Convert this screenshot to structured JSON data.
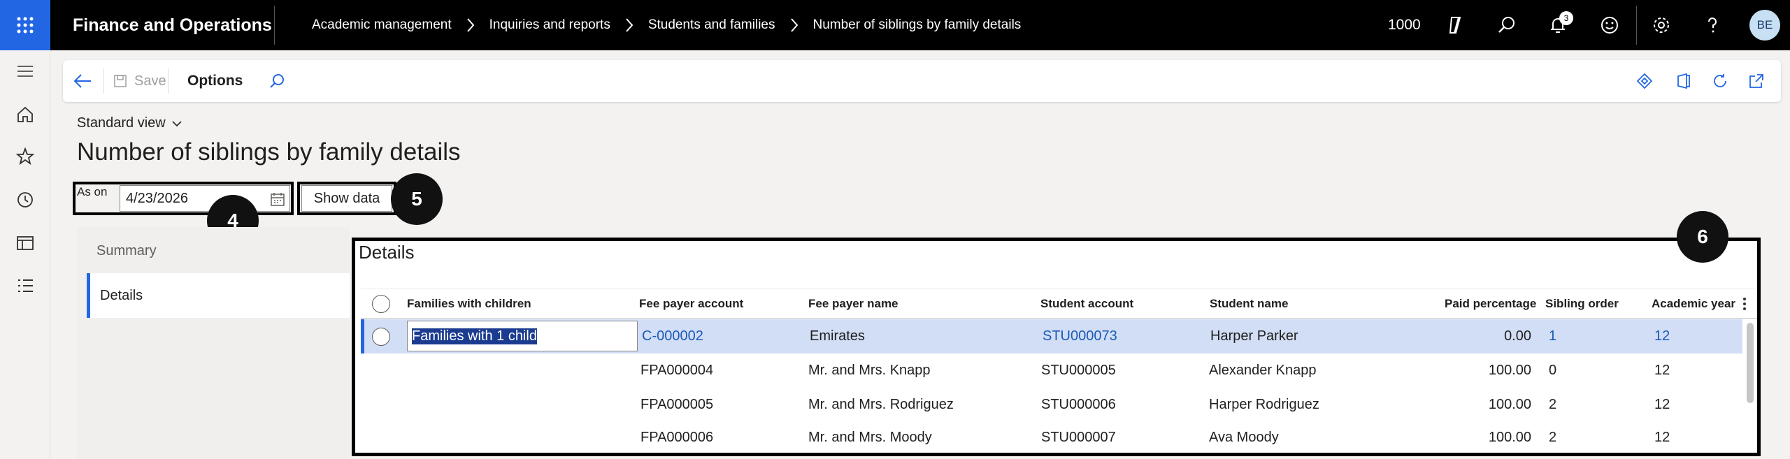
{
  "topbar": {
    "app_title": "Finance and Operations",
    "breadcrumbs": [
      "Academic management",
      "Inquiries and reports",
      "Students and families",
      "Number of siblings by family details"
    ],
    "company": "1000",
    "notification_count": "3",
    "avatar_initials": "BE"
  },
  "actionpane": {
    "save_label": "Save",
    "options_label": "Options"
  },
  "view": {
    "standard_view_label": "Standard view"
  },
  "page": {
    "title": "Number of siblings by family details"
  },
  "filters": {
    "as_on_label": "As on",
    "as_on_value": "4/23/2026",
    "show_data_label": "Show data"
  },
  "markers": {
    "m4": "4",
    "m5": "5",
    "m6": "6"
  },
  "tabs": {
    "summary": "Summary",
    "details": "Details"
  },
  "details": {
    "title": "Details",
    "columns": {
      "families": "Families with children",
      "fee_payer_account": "Fee payer account",
      "fee_payer_name": "Fee payer name",
      "student_account": "Student account",
      "student_name": "Student name",
      "paid_percentage": "Paid percentage",
      "sibling_order": "Sibling order",
      "academic_year": "Academic year"
    },
    "rows": [
      {
        "families": "Families with 1 child",
        "fee_payer_account": "C-000002",
        "fee_payer_name": "Emirates",
        "student_account": "STU000073",
        "student_name": "Harper Parker",
        "paid_percentage": "0.00",
        "sibling_order": "1",
        "academic_year": "12"
      },
      {
        "families": "",
        "fee_payer_account": "FPA000004",
        "fee_payer_name": "Mr. and Mrs. Knapp",
        "student_account": "STU000005",
        "student_name": "Alexander Knapp",
        "paid_percentage": "100.00",
        "sibling_order": "0",
        "academic_year": "12"
      },
      {
        "families": "",
        "fee_payer_account": "FPA000005",
        "fee_payer_name": "Mr. and Mrs. Rodriguez",
        "student_account": "STU000006",
        "student_name": "Harper Rodriguez",
        "paid_percentage": "100.00",
        "sibling_order": "2",
        "academic_year": "12"
      },
      {
        "families": "",
        "fee_payer_account": "FPA000006",
        "fee_payer_name": "Mr. and Mrs. Moody",
        "student_account": "STU000007",
        "student_name": "Ava Moody",
        "paid_percentage": "100.00",
        "sibling_order": "2",
        "academic_year": "12"
      }
    ]
  },
  "colors": {
    "accent": "#2266e3",
    "selected_row": "#d1def5",
    "link": "#1b5ab7"
  },
  "icons": [
    "waffle-icon",
    "copilot-icon",
    "search-icon",
    "bell-icon",
    "smiley-icon",
    "gear-icon",
    "help-icon",
    "hamburger-icon",
    "home-icon",
    "star-icon",
    "clock-icon",
    "workspace-icon",
    "list-icon",
    "back-icon",
    "save-icon",
    "diamond-icon",
    "office-icon",
    "refresh-icon",
    "popout-icon",
    "calendar-icon",
    "chevron-down-icon",
    "more-icon"
  ]
}
